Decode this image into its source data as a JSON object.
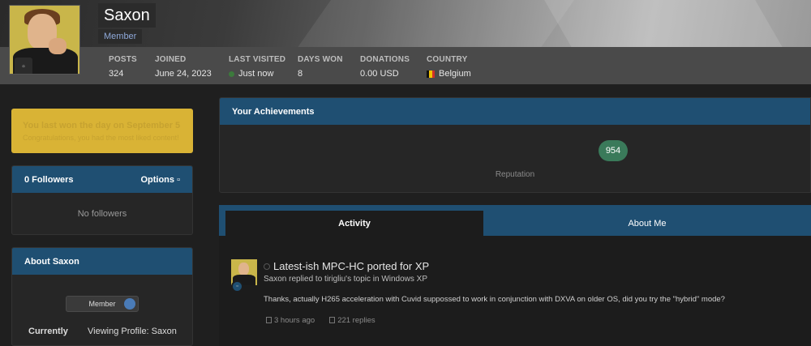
{
  "profile": {
    "name": "Saxon",
    "rank": "Member"
  },
  "stats": [
    {
      "label": "POSTS",
      "value": "324"
    },
    {
      "label": "JOINED",
      "value": "June 24, 2023"
    },
    {
      "label": "LAST VISITED",
      "value": "Just now"
    },
    {
      "label": "DAYS WON",
      "value": "8"
    },
    {
      "label": "DONATIONS",
      "value": "0.00 USD"
    },
    {
      "label": "COUNTRY",
      "value": "Belgium"
    }
  ],
  "award": {
    "title": "You last won the day on September 5",
    "subtitle": "Congratulations, you had the most liked content!"
  },
  "followers_panel": {
    "title": "0 Followers",
    "options_label": "Options",
    "empty_text": "No followers"
  },
  "about_panel": {
    "title": "About Saxon",
    "badge_label": "Member",
    "current_key": "Currently",
    "current_value": "Viewing Profile: Saxon"
  },
  "achievements": {
    "title": "Your Achievements",
    "reputation_value": "954",
    "reputation_label": "Reputation"
  },
  "tabs": {
    "activity": "Activity",
    "about": "About Me"
  },
  "activity_item": {
    "title": "Latest-ish MPC-HC ported for XP",
    "subtitle": "Saxon replied to tirigliu's topic in Windows XP",
    "snippet": "Thanks, actually H265 acceleration with Cuvid suppossed to work in conjunction with DXVA on older OS, did you try the \"hybrid\" mode?",
    "time": "3 hours ago",
    "replies": "221 replies"
  },
  "colors": {
    "accent_blue": "#1f4f72",
    "award_yellow": "#d9b335",
    "reputation_green": "#3a7a5a"
  }
}
